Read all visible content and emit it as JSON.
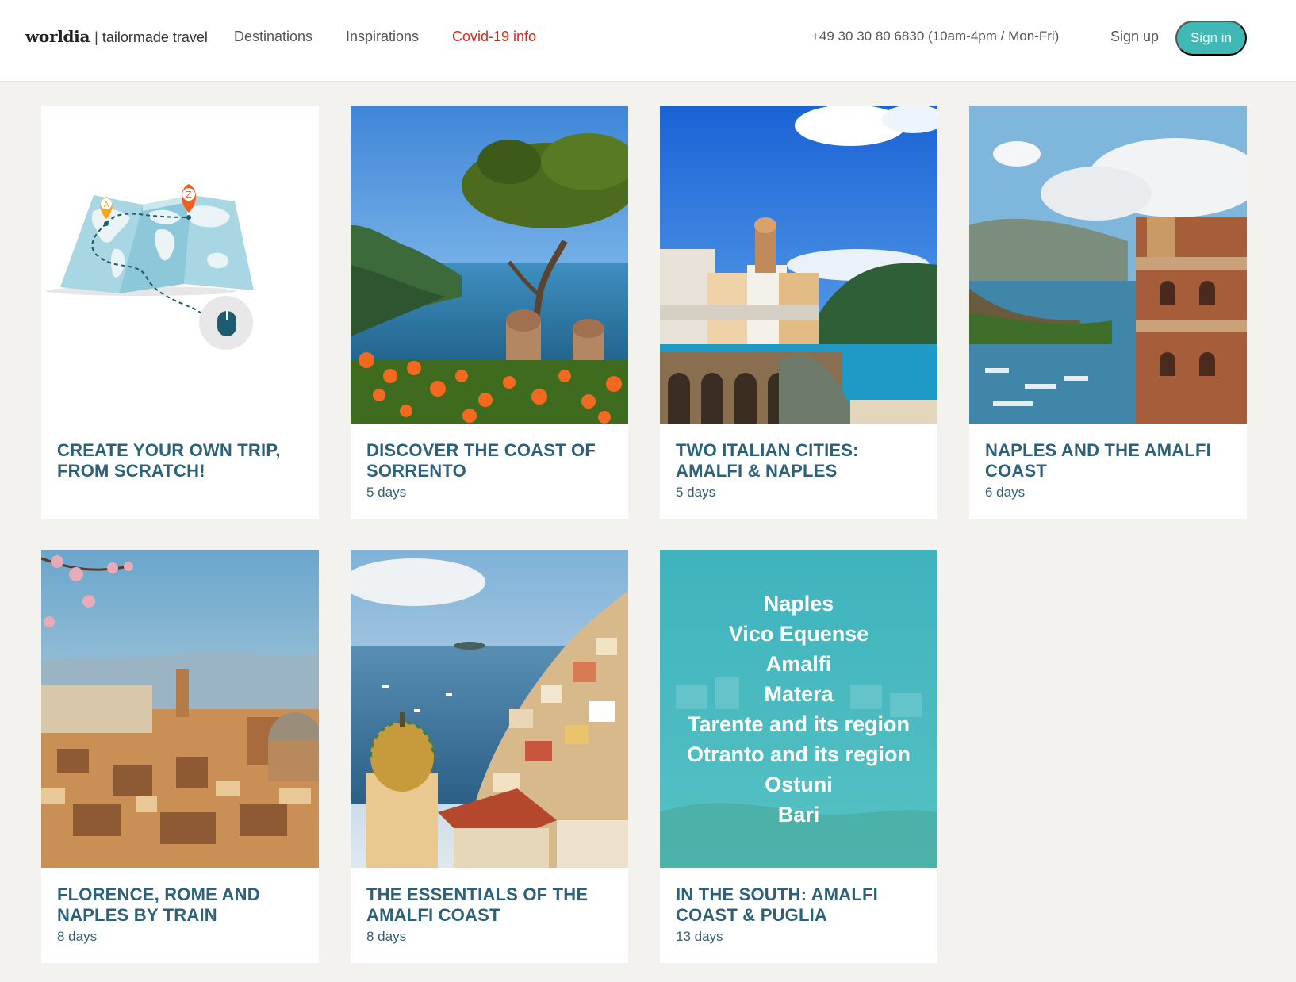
{
  "header": {
    "logo_mark": "worldia",
    "logo_separator": "|",
    "logo_tagline": "tailormade travel",
    "nav": {
      "destinations": "Destinations",
      "inspirations": "Inspirations",
      "covid": "Covid-19 info"
    },
    "phone": "+49 30 30 80 6830 (10am-4pm / Mon-Fri)",
    "signup_label": "Sign up",
    "signin_label": "Sign in"
  },
  "colors": {
    "accent": "#3fb8b6",
    "alert": "#e4221c",
    "title": "#2c6179",
    "background": "#f3f2ee"
  },
  "cards": [
    {
      "title": "Create your own trip, from scratch!",
      "days": ""
    },
    {
      "title": "Discover the coast of Sorrento",
      "days": "5 days"
    },
    {
      "title": "Two Italian cities: Amalfi & Naples",
      "days": "5 days"
    },
    {
      "title": "Naples and the Amalfi Coast",
      "days": "6 days"
    },
    {
      "title": "Florence, Rome and Naples by train",
      "days": "8 days"
    },
    {
      "title": "The essentials of the Amalfi Coast",
      "days": "8 days"
    },
    {
      "title": "In the south: Amalfi Coast & Puglia",
      "days": "13 days",
      "stops": [
        "Naples",
        "Vico Equense",
        "Amalfi",
        "Matera",
        "Tarente and its region",
        "Otranto and its region",
        "Ostuni",
        "Bari"
      ]
    }
  ],
  "map_pins": {
    "start": "A",
    "end": "Z"
  }
}
